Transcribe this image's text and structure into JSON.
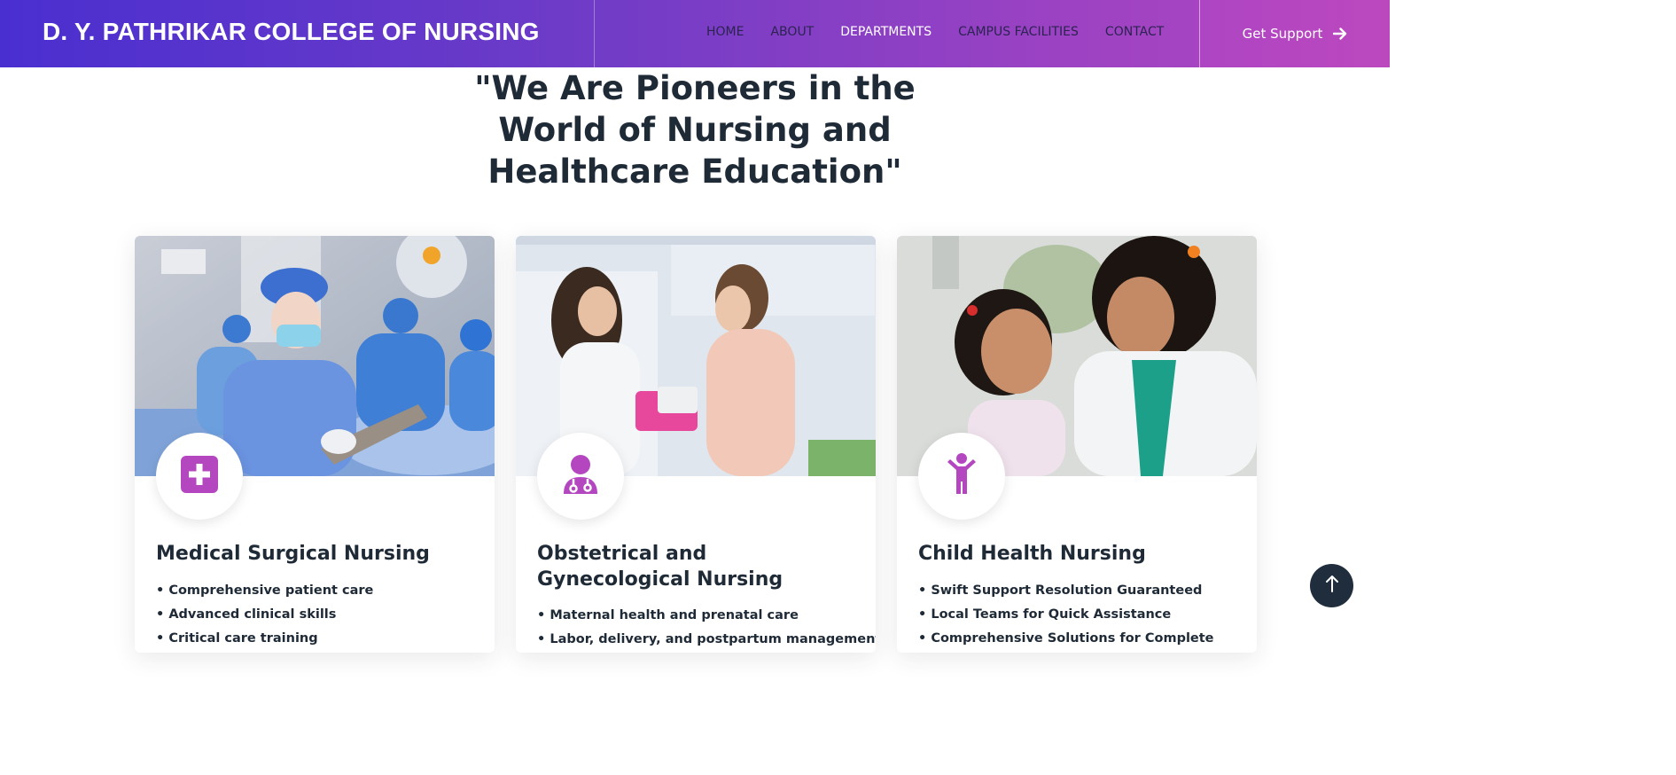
{
  "header": {
    "brand": "D. Y. PATHRIKAR COLLEGE OF NURSING",
    "nav": [
      {
        "label": "HOME",
        "active": false
      },
      {
        "label": "ABOUT",
        "active": false
      },
      {
        "label": "DEPARTMENTS",
        "active": true
      },
      {
        "label": "CAMPUS FACILITIES",
        "active": false
      },
      {
        "label": "CONTACT",
        "active": false
      }
    ],
    "support_label": "Get Support",
    "support_icon": "arrow-right-icon"
  },
  "hero": {
    "title": "\"We Are Pioneers in the World of Nursing and Healthcare Education\""
  },
  "cards": [
    {
      "title": "Medical Surgical Nursing",
      "icon": "medical-cross-icon",
      "items": [
        "Comprehensive patient care",
        "Advanced clinical skills",
        "Critical care training"
      ]
    },
    {
      "title": "Obstetrical and Gynecological Nursing",
      "icon": "doctor-stethoscope-icon",
      "items": [
        "Maternal health and prenatal care",
        "Labor, delivery, and postpartum management"
      ]
    },
    {
      "title": "Child Health Nursing",
      "icon": "child-icon",
      "items": [
        "Swift Support Resolution Guaranteed",
        "Local Teams for Quick Assistance",
        "Comprehensive Solutions for Complete"
      ]
    }
  ],
  "colors": {
    "accent": "#b447c0",
    "header_start": "#4a2fd0",
    "header_end": "#b447c0",
    "text_dark": "#1f2a37",
    "scroll_button": "#1f2d3d"
  },
  "scroll_top_icon": "arrow-up-icon"
}
